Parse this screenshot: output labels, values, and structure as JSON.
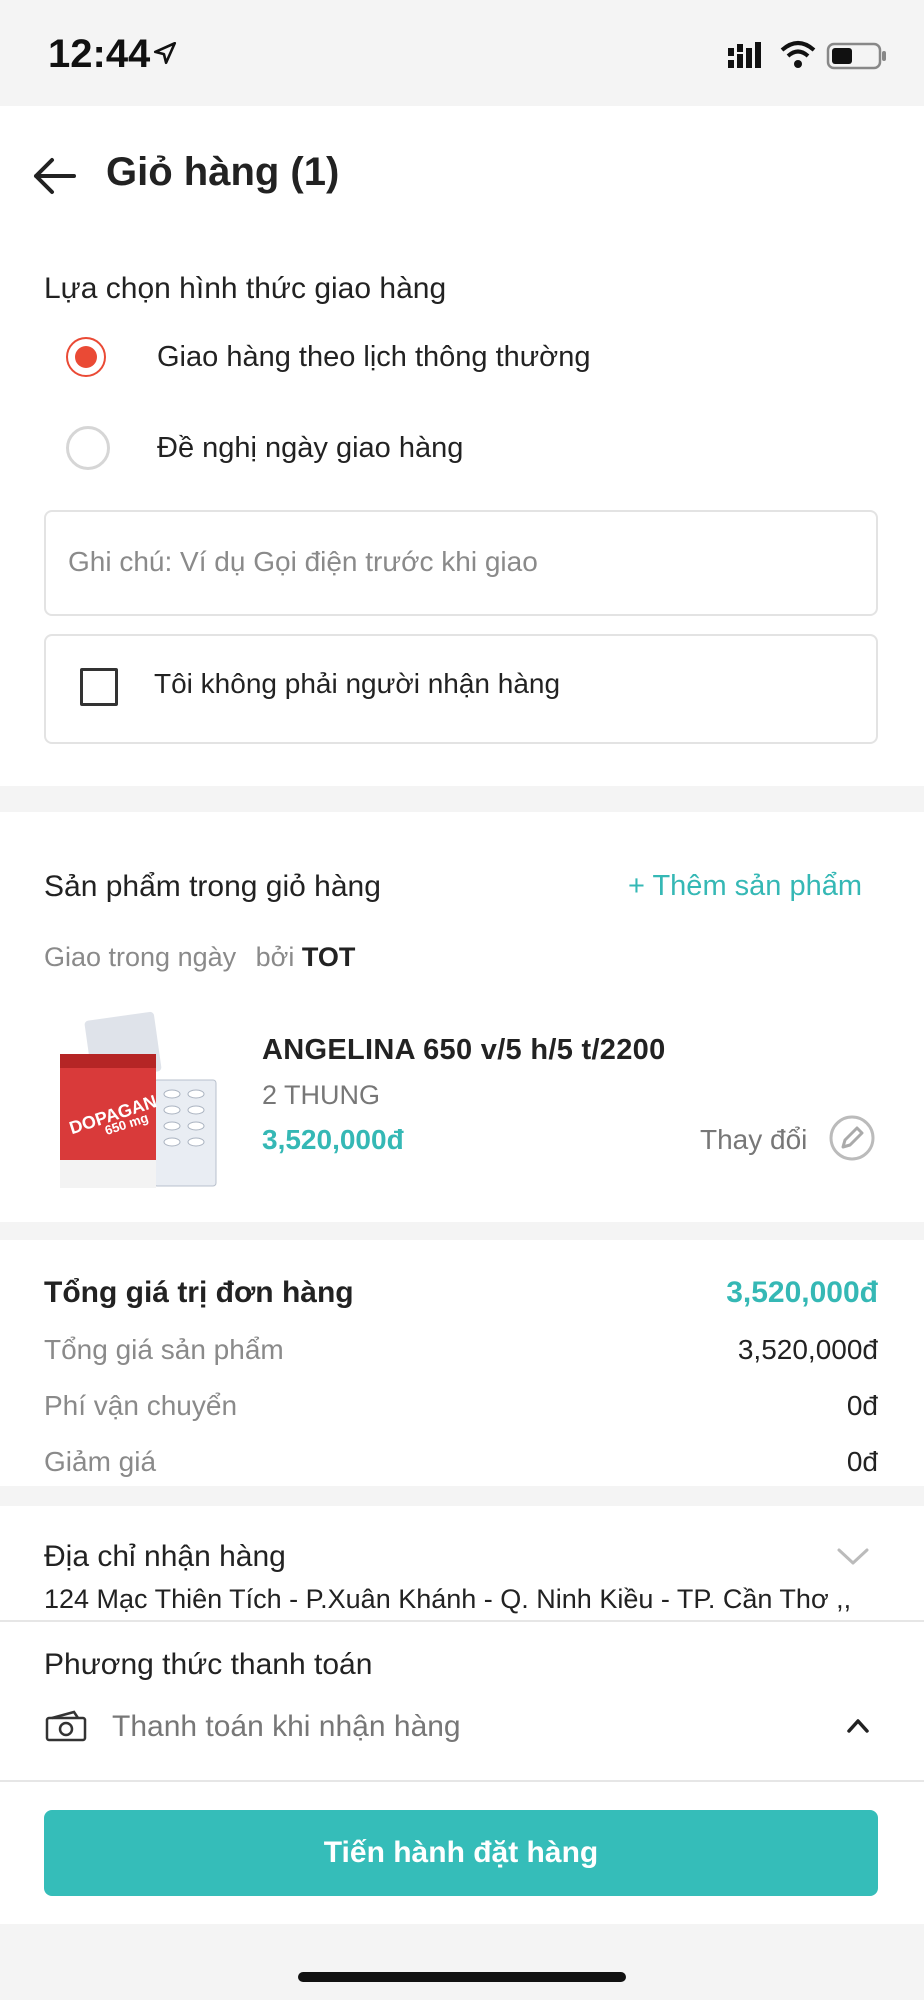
{
  "status_bar": {
    "time": "12:44"
  },
  "header": {
    "title": "Giỏ hàng (1)"
  },
  "delivery": {
    "title": "Lựa chọn hình thức giao hàng",
    "options": [
      {
        "label": "Giao hàng theo lịch thông thường",
        "selected": true
      },
      {
        "label": "Đề nghị ngày giao hàng",
        "selected": false
      }
    ],
    "note_placeholder": "Ghi chú: Ví dụ Gọi điện trước khi giao",
    "not_recipient_label": "Tôi không phải người nhận hàng"
  },
  "products": {
    "title": "Sản phẩm trong giỏ hàng",
    "add_label": "+ Thêm sản phẩm",
    "delivery_prefix": "Giao trong ngày",
    "by_label": "bởi",
    "seller": "TOT",
    "items": [
      {
        "name": "ANGELINA 650 v/5 h/5 t/2200",
        "unit": "2 THUNG",
        "price": "3,520,000đ",
        "change_label": "Thay đổi",
        "image_brand": "DOPAGAN",
        "image_dose": "650 mg"
      }
    ]
  },
  "summary": {
    "total_label": "Tổng giá trị đơn hàng",
    "total_value": "3,520,000đ",
    "rows": [
      {
        "label": "Tổng giá sản phẩm",
        "value": "3,520,000đ"
      },
      {
        "label": "Phí vận chuyển",
        "value": "0đ"
      },
      {
        "label": "Giảm giá",
        "value": "0đ"
      }
    ]
  },
  "address": {
    "title": "Địa chỉ nhận hàng",
    "value": "124 Mạc Thiên Tích - P.Xuân Khánh - Q. Ninh Kiều - TP. Cần Thơ ,,"
  },
  "payment": {
    "title": "Phương thức thanh toán",
    "method": "Thanh toán khi nhận hàng"
  },
  "cta": {
    "label": "Tiến hành đặt hàng"
  },
  "colors": {
    "accent": "#35bdb9",
    "radio_selected": "#ea4a35",
    "price": "#35b8b5"
  }
}
